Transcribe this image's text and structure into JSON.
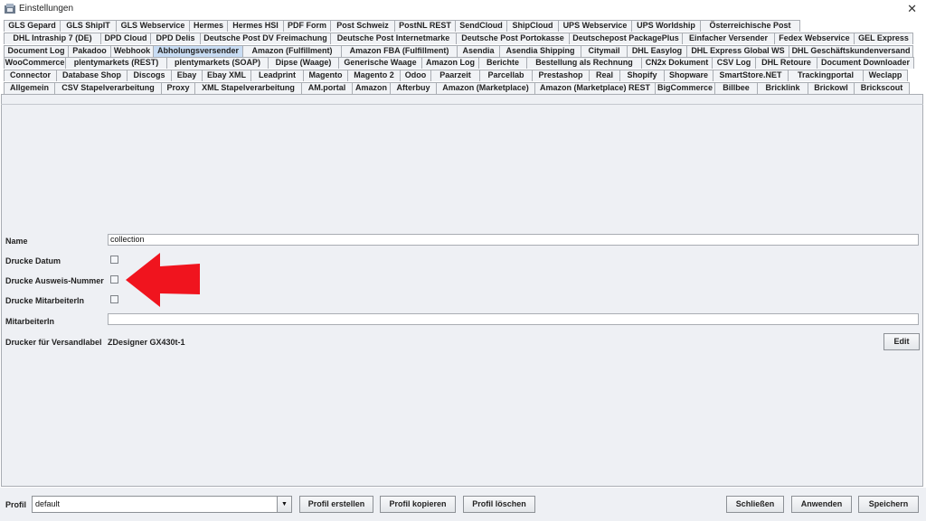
{
  "window": {
    "title": "Einstellungen",
    "close_glyph": "✕"
  },
  "tab_rows": [
    [
      "GLS Gepard",
      "GLS ShipIT",
      "GLS Webservice",
      "Hermes",
      "Hermes HSI",
      "PDF Form",
      "Post Schweiz",
      "PostNL REST",
      "SendCloud",
      "ShipCloud",
      "UPS Webservice",
      "UPS Worldship",
      "Österreichische Post"
    ],
    [
      "DHL Intraship 7 (DE)",
      "DPD Cloud",
      "DPD Delis",
      "Deutsche Post DV Freimachung",
      "Deutsche Post Internetmarke",
      "Deutsche Post Portokasse",
      "Deutschepost PackagePlus",
      "Einfacher Versender",
      "Fedex Webservice",
      "GEL Express"
    ],
    [
      "Document Log",
      "Pakadoo",
      "Webhook",
      "Abholungsversender",
      "Amazon (Fulfillment)",
      "Amazon FBA (Fulfillment)",
      "Asendia",
      "Asendia Shipping",
      "Citymail",
      "DHL Easylog",
      "DHL Express Global WS",
      "DHL Geschäftskundenversand"
    ],
    [
      "WooCommerce",
      "plentymarkets (REST)",
      "plentymarkets (SOAP)",
      "Dipse (Waage)",
      "Generische Waage",
      "Amazon Log",
      "Berichte",
      "Bestellung als Rechnung",
      "CN2x Dokument",
      "CSV Log",
      "DHL Retoure",
      "Document Downloader"
    ],
    [
      "Connector",
      "Database Shop",
      "Discogs",
      "Ebay",
      "Ebay XML",
      "Leadprint",
      "Magento",
      "Magento 2",
      "Odoo",
      "Paarzeit",
      "Parcellab",
      "Prestashop",
      "Real",
      "Shopify",
      "Shopware",
      "SmartStore.NET",
      "Trackingportal",
      "Weclapp"
    ],
    [
      "Allgemein",
      "CSV Stapelverarbeitung",
      "Proxy",
      "XML Stapelverarbeitung",
      "AM.portal",
      "Amazon",
      "Afterbuy",
      "Amazon (Marketplace)",
      "Amazon (Marketplace) REST",
      "BigCommerce",
      "Billbee",
      "Bricklink",
      "Brickowl",
      "Brickscout"
    ]
  ],
  "active_tab": "Abholungsversender",
  "form": {
    "name_label": "Name",
    "name_value": "collection",
    "drucke_datum_label": "Drucke Datum",
    "drucke_ausweis_label": "Drucke Ausweis-Nummer",
    "drucke_mitarbeiter_label": "Drucke MitarbeiterIn",
    "mitarbeiter_label": "MitarbeiterIn",
    "mitarbeiter_value": "",
    "drucker_label": "Drucker für Versandlabel",
    "drucker_value": "ZDesigner GX430t-1",
    "edit_label": "Edit"
  },
  "bottom": {
    "profil_label": "Profil",
    "profil_value": "default",
    "dropdown_glyph": "▼",
    "erstellen": "Profil erstellen",
    "kopieren": "Profil kopieren",
    "loeschen": "Profil löschen",
    "schliessen": "Schließen",
    "anwenden": "Anwenden",
    "speichern": "Speichern"
  },
  "colors": {
    "arrow": "#f0141e",
    "active_tab": "#c8dcf3",
    "panel": "#eef0f4"
  }
}
